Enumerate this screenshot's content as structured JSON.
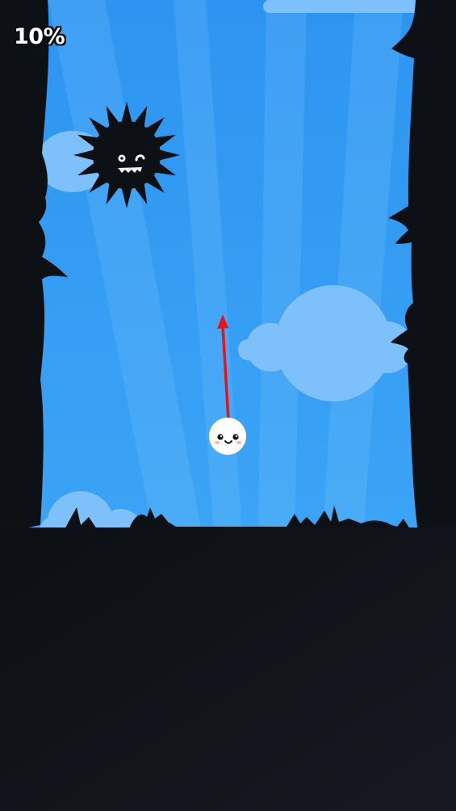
{
  "hud": {
    "progress_text": "10%",
    "progress_value": 0.1
  },
  "colors": {
    "sky_top": "#2d96f2",
    "sky_bottom": "#3aa2f4",
    "cloud": "#7dc0fb",
    "silhouette": "#0d1014",
    "ground": "#11151a",
    "player": "#ffffff",
    "aim_arrow": "#e5141b"
  },
  "entities": {
    "player": "white-ball-player",
    "enemy": "black-spiky-monster",
    "aim": "red-aim-arrow"
  }
}
